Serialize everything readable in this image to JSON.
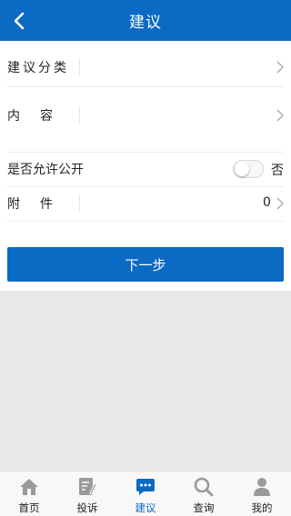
{
  "header": {
    "title": "建议",
    "back_icon": "chevron-left-icon"
  },
  "form": {
    "category_label": "建议分类",
    "content_label": "内　容",
    "public_label": "是否允许公开",
    "public_value": "否",
    "public_enabled": false,
    "attachment_label": "附　件",
    "attachment_count": "0"
  },
  "next_button": "下一步",
  "tabbar": {
    "items": [
      {
        "label": "首页",
        "icon": "home-icon",
        "active": false
      },
      {
        "label": "投诉",
        "icon": "complaint-icon",
        "active": false
      },
      {
        "label": "建议",
        "icon": "suggestion-chat-icon",
        "active": true
      },
      {
        "label": "查询",
        "icon": "search-icon",
        "active": false
      },
      {
        "label": "我的",
        "icon": "profile-icon",
        "active": false
      }
    ]
  },
  "colors": {
    "brand": "#0b6ac4",
    "inactive_icon": "#9a9a9a",
    "gray_area": "#e9e9e9"
  }
}
